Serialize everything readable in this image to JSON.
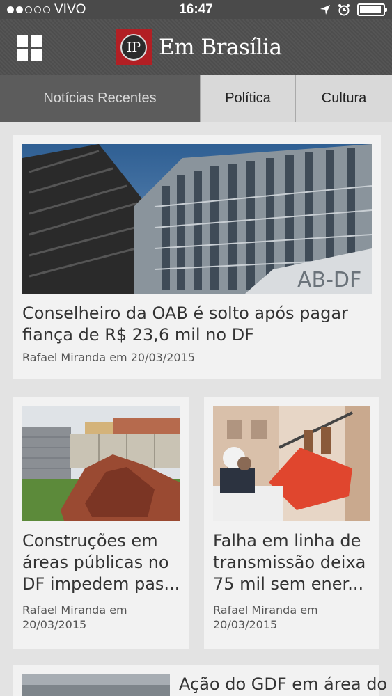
{
  "status": {
    "carrier": "VIVO",
    "time": "16:47"
  },
  "header": {
    "logo_initials": "IP",
    "title": "Em Brasília"
  },
  "tabs": [
    {
      "label": "Notícias Recentes",
      "active": true
    },
    {
      "label": "Política",
      "active": false
    },
    {
      "label": "Cultura",
      "active": false
    }
  ],
  "articles": [
    {
      "title": "Conselheiro da OAB é solto após pagar fiança de R$ 23,6 mil no DF",
      "meta": "Rafael Miranda em 20/03/2015",
      "image_sign": "AB-DF"
    },
    {
      "title": "Construções em áreas públicas no DF impedem pas...",
      "meta": "Rafael Miranda em 20/03/2015"
    },
    {
      "title": "Falha em linha de transmissão deixa 75 mil sem ener...",
      "meta": "Rafael Miranda em 20/03/2015"
    },
    {
      "title": "Ação do GDF em área do"
    }
  ],
  "colors": {
    "header_bg": "#4d4d4d",
    "logo_red": "#b21f24",
    "tab_active_bg": "#5c5c5c",
    "tab_inactive_bg": "#d9d9d9",
    "page_bg": "#e3e3e3",
    "card_bg": "#f2f2f2"
  }
}
